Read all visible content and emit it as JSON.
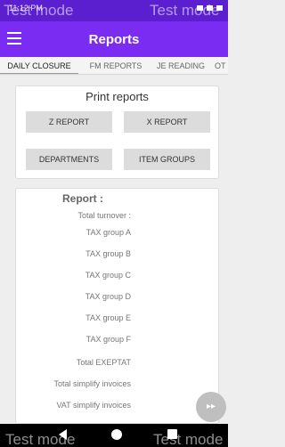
{
  "status_bar": {
    "time": "11:12 PM"
  },
  "watermark": "Test mode",
  "header": {
    "title": "Reports",
    "menu_icon": "hamburger-icon"
  },
  "tabs": [
    {
      "label": "DAILY CLOSURE",
      "active": true
    },
    {
      "label": "FM REPORTS",
      "active": false
    },
    {
      "label": "JE READING",
      "active": false
    },
    {
      "label": "OT",
      "active": false
    }
  ],
  "print_reports": {
    "title": "Print reports",
    "buttons": [
      "Z REPORT",
      "X REPORT",
      "DEPARTMENTS",
      "ITEM GROUPS"
    ]
  },
  "report": {
    "title": "Report :",
    "rows": [
      "Total turnover :",
      "TAX group A",
      "TAX group B",
      "TAX group C",
      "TAX group D",
      "TAX group E",
      "TAX group F",
      "Total  EXEPTAT",
      "Total simplify invoices",
      "VAT simplify invoices"
    ]
  },
  "fab_icon": "fast-forward-icon",
  "colors": {
    "status_bar": "#5b1fcf",
    "app_bar": "#7a2cf2",
    "button": "#dcdcdc",
    "background": "#eeeeee"
  }
}
